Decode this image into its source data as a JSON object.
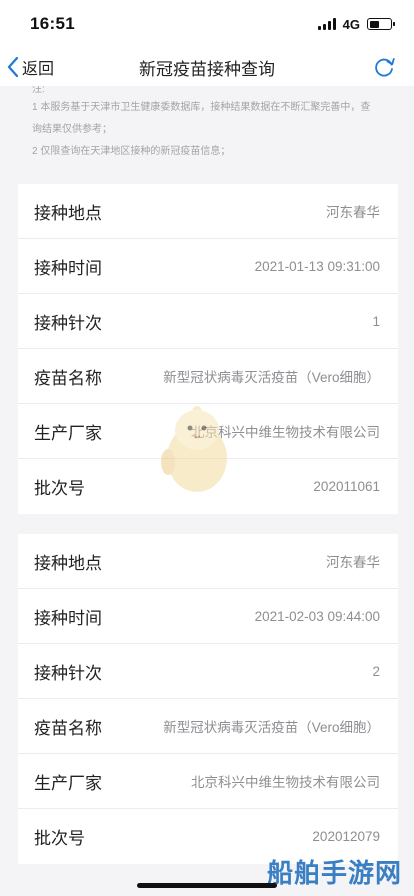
{
  "status_bar": {
    "time": "16:51",
    "network": "4G",
    "battery_level": 0.45
  },
  "nav": {
    "back_label": "返回",
    "title": "新冠疫苗接种查询",
    "refresh_icon": "refresh-icon"
  },
  "notes": [
    "注:",
    "1 本服务基于天津市卫生健康委数据库，接种结果数据在不断汇聚完善中，查",
    "询结果仅供参考；",
    "2 仅限查询在天津地区接种的新冠疫苗信息；"
  ],
  "records": [
    {
      "rows": [
        {
          "label": "接种地点",
          "value": "河东春华"
        },
        {
          "label": "接种时间",
          "value": "2021-01-13 09:31:00"
        },
        {
          "label": "接种针次",
          "value": "1"
        },
        {
          "label": "疫苗名称",
          "value": "新型冠状病毒灭活疫苗（Vero细胞）"
        },
        {
          "label": "生产厂家",
          "value": "北京科兴中维生物技术有限公司"
        },
        {
          "label": "批次号",
          "value": "202011061"
        }
      ]
    },
    {
      "rows": [
        {
          "label": "接种地点",
          "value": "河东春华"
        },
        {
          "label": "接种时间",
          "value": "2021-02-03 09:44:00"
        },
        {
          "label": "接种针次",
          "value": "2"
        },
        {
          "label": "疫苗名称",
          "value": "新型冠状病毒灭活疫苗（Vero细胞）"
        },
        {
          "label": "生产厂家",
          "value": "北京科兴中维生物技术有限公司"
        },
        {
          "label": "批次号",
          "value": "202012079"
        }
      ]
    }
  ],
  "footer": {
    "brand": "船舶手游网"
  },
  "colors": {
    "accent": "#1a7ad9",
    "background": "#f4f4f6",
    "card": "#ffffff",
    "value_text": "#8e8e93"
  }
}
